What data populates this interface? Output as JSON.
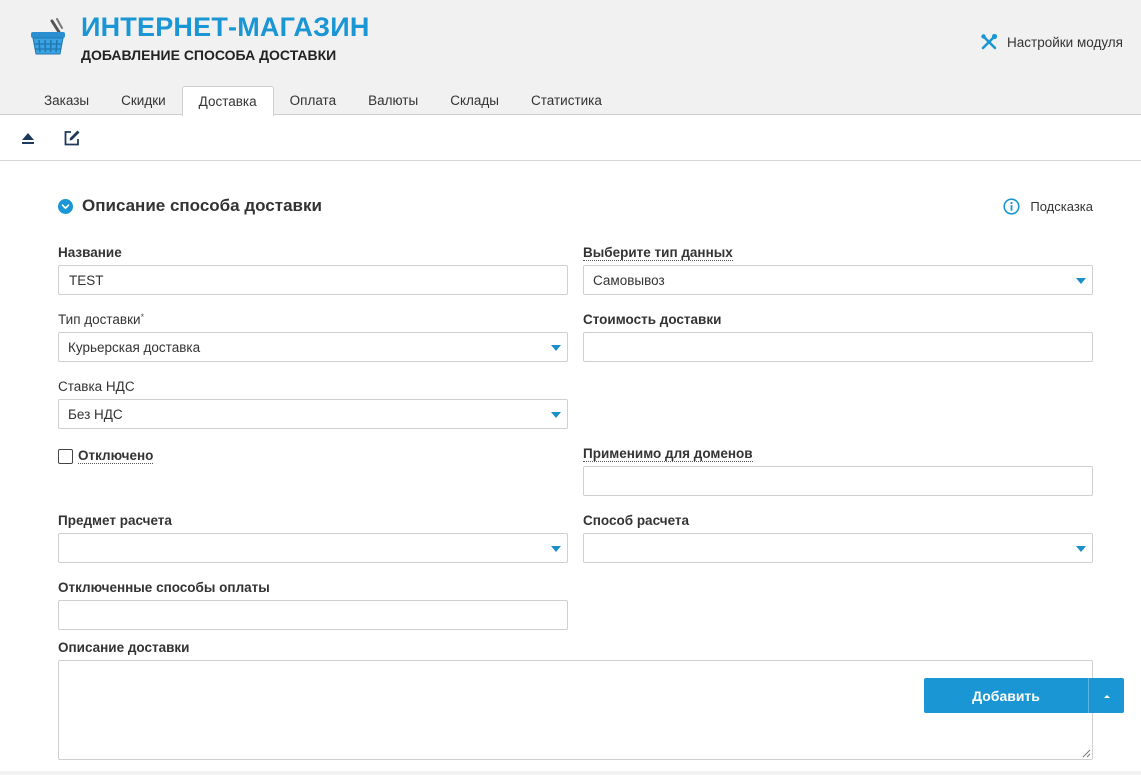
{
  "header": {
    "app_title": "ИНТЕРНЕТ-МАГАЗИН",
    "subtitle": "ДОБАВЛЕНИЕ СПОСОБА ДОСТАВКИ",
    "logo_icon": "shopping-basket-icon",
    "module_settings_label": "Настройки модуля",
    "module_settings_icon": "tools-icon"
  },
  "tabs": [
    {
      "label": "Заказы",
      "active": false
    },
    {
      "label": "Скидки",
      "active": false
    },
    {
      "label": "Доставка",
      "active": true
    },
    {
      "label": "Оплата",
      "active": false
    },
    {
      "label": "Валюты",
      "active": false
    },
    {
      "label": "Склады",
      "active": false
    },
    {
      "label": "Статистика",
      "active": false
    }
  ],
  "toolbar": {
    "buttons": [
      {
        "icon": "eject-icon"
      },
      {
        "icon": "edit-icon"
      }
    ]
  },
  "section": {
    "title": "Описание способа доставки",
    "toggle_icon": "chevron-down-circle-icon",
    "hint_label": "Подсказка",
    "hint_icon": "info-icon"
  },
  "form": {
    "name": {
      "label": "Название",
      "value": "TEST"
    },
    "data_type": {
      "label": "Выберите тип данных",
      "value": "Самовывоз"
    },
    "delivery_type": {
      "label": "Тип доставки",
      "required_mark": "*",
      "value": "Курьерская доставка"
    },
    "delivery_cost": {
      "label": "Стоимость доставки",
      "value": ""
    },
    "vat_rate": {
      "label": "Ставка НДС",
      "value": "Без НДС"
    },
    "disabled": {
      "label": "Отключено",
      "checked": false
    },
    "domains": {
      "label": "Применимо для доменов",
      "value": ""
    },
    "payment_subject": {
      "label": "Предмет расчета",
      "value": ""
    },
    "payment_method": {
      "label": "Способ расчета",
      "value": ""
    },
    "disabled_payment_methods": {
      "label": "Отключенные способы оплаты",
      "value": ""
    },
    "description": {
      "label": "Описание доставки",
      "value": ""
    }
  },
  "actions": {
    "add_label": "Добавить"
  },
  "colors": {
    "accent": "#1a96d4",
    "header_bg": "#f1f1f1"
  }
}
